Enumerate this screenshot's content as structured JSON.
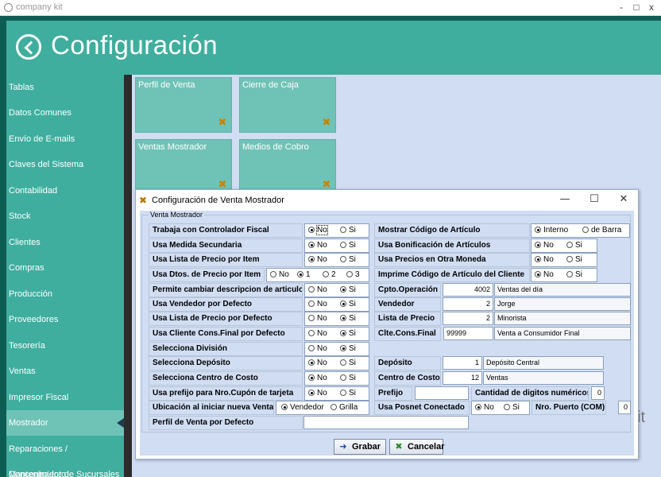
{
  "window": {
    "title": "company kit",
    "minimize": "-",
    "maximize": "□",
    "close": "x"
  },
  "header": {
    "title": "Configuración"
  },
  "sidebar": {
    "items": [
      {
        "label": "Tablas"
      },
      {
        "label": "Datos Comunes"
      },
      {
        "label": "Envío de E-mails"
      },
      {
        "label": "Claves del Sistema"
      },
      {
        "label": "Contabilidad"
      },
      {
        "label": "Stock"
      },
      {
        "label": "Clientes"
      },
      {
        "label": "Compras"
      },
      {
        "label": "Producción"
      },
      {
        "label": "Proveedores"
      },
      {
        "label": "Tesorería"
      },
      {
        "label": "Ventas"
      },
      {
        "label": "Impresor Fiscal"
      },
      {
        "label": "Mostrador"
      },
      {
        "label": "Reparaciones / Mantenimiento"
      },
      {
        "label": "Concentrador de Sucursales"
      }
    ],
    "active": "Mostrador"
  },
  "tiles": [
    {
      "label": "Perfil de Venta"
    },
    {
      "label": "Cierre de Caja"
    },
    {
      "label": "Ventas Mostrador"
    },
    {
      "label": "Medios de Cobro"
    }
  ],
  "watermark": "it",
  "colors": {
    "header_bg": "#3fae9e",
    "frame_bg": "#0e5d55",
    "tile_bg": "#6fc3b6",
    "content_bg": "#d0ddf2"
  },
  "dialog": {
    "title": "Configuración de Venta Mostrador",
    "controls": {
      "minimize": "—",
      "maximize": "☐",
      "close": "✕"
    },
    "group_title": "Venta Mostrador",
    "left": {
      "r1": {
        "label": "Trabaja con Controlador Fiscal",
        "opts": [
          "No",
          "Si"
        ]
      },
      "r2": {
        "label": "Usa Medida Secundaria",
        "opts": [
          "No",
          "Si"
        ]
      },
      "r3": {
        "label": "Usa Lista de Precio por Item",
        "opts": [
          "No",
          "Si"
        ]
      },
      "r4": {
        "label": "Usa Dtos. de Precio por Item",
        "opts": [
          "No",
          "1",
          "2",
          "3"
        ]
      },
      "r5": {
        "label": "Permite cambiar descripcion de articulos",
        "opts": [
          "No",
          "Si"
        ]
      },
      "r6": {
        "label": "Usa Vendedor por Defecto",
        "opts": [
          "No",
          "Si"
        ]
      },
      "r7": {
        "label": "Usa Lista de Precio por Defecto",
        "opts": [
          "No",
          "Si"
        ]
      },
      "r8": {
        "label": "Usa Cliente Cons.Final por Defecto",
        "opts": [
          "No",
          "Si"
        ]
      },
      "r9": {
        "label": "Selecciona División",
        "opts": [
          "No",
          "Si"
        ]
      },
      "r10": {
        "label": "Selecciona Depósito",
        "opts": [
          "No",
          "Si"
        ]
      },
      "r11": {
        "label": "Selecciona Centro de Costo",
        "opts": [
          "No",
          "Si"
        ]
      },
      "r12": {
        "label": "Usa prefijo para Nro.Cupón de tarjeta",
        "opts": [
          "No",
          "Si"
        ]
      },
      "r13": {
        "label": "Ubicación al iniciar nueva Venta",
        "opts": [
          "Vendedor",
          "Grilla"
        ]
      },
      "r14": {
        "label": "Perfil de Venta por Defecto",
        "value": ""
      }
    },
    "right": {
      "r1": {
        "label": "Mostrar Código de Artículo",
        "opts": [
          "Interno",
          "de Barra"
        ]
      },
      "r2": {
        "label": "Usa Bonificación de Artículos",
        "opts": [
          "No",
          "Si"
        ]
      },
      "r3": {
        "label": "Usa Precios en Otra Moneda",
        "opts": [
          "No",
          "Si"
        ]
      },
      "r4": {
        "label": "Imprime Código de Artículo del Cliente",
        "opts": [
          "No",
          "Si"
        ]
      },
      "r5": {
        "label": "Cpto.Operación",
        "code": "4002",
        "desc": "Ventas del día"
      },
      "r6": {
        "label": "Vendedor",
        "code": "2",
        "desc": "Jorge"
      },
      "r7": {
        "label": "Lista de Precio",
        "code": "2",
        "desc": "Minorista"
      },
      "r8": {
        "label": "Clte.Cons.Final",
        "code": "99999",
        "desc": "Venta a Consumidor Final"
      },
      "r10": {
        "label": "Depósito",
        "code": "1",
        "desc": "Depósito Central"
      },
      "r11": {
        "label": "Centro de Costo",
        "code": "12",
        "desc": "Ventas"
      },
      "r12": {
        "label": "Prefijo",
        "value": "",
        "label2": "Cantidad de digitos numéricos",
        "value2": "0"
      },
      "r13": {
        "label": "Usa Posnet Conectado",
        "opts": [
          "No",
          "Si"
        ],
        "label2": "Nro. Puerto (COM)",
        "value2": "0"
      }
    },
    "buttons": {
      "ok": "Grabar",
      "cancel": "Cancelar"
    }
  }
}
